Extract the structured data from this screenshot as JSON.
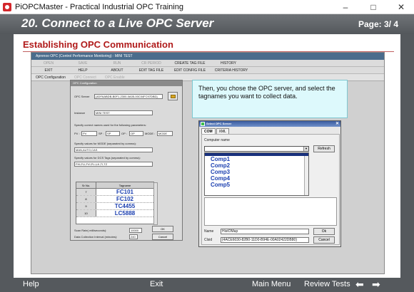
{
  "window": {
    "title": "PiOPCMaster - Practical Industrial OPC Training",
    "minimize": "–",
    "maximize": "□",
    "close": "✕"
  },
  "header": {
    "title": "20. Connect to a Live OPC Server",
    "page": "Page: 3/ 4"
  },
  "slide": {
    "heading": "Establishing OPC Communication"
  },
  "app": {
    "title": "Aprenoo OPC (Control Performance Monitoring) : MINI TEST",
    "menu_row1": [
      "OPEN",
      "SAVE",
      "RUN",
      "CR PERIOD",
      "CREATE TAG FILE",
      "HISTORY"
    ],
    "menu_row2": [
      "EXIT",
      "HELP",
      "ABOUT",
      "EDIT TAG FILE",
      "EDIT CONFIG FILE",
      "CRITERIA HISTORY"
    ],
    "tabs": [
      "OPC Configuration",
      "OPC Connect",
      "OPC Enable"
    ]
  },
  "opc_config": {
    "title": "OPC Configuration",
    "server_label": "OPC Server",
    "server_value": "{4DFAABDB-B0F1-2300-0A05-00C04FC97DBD}",
    "instance_label": "Instance",
    "instance_value": "MINI TEST",
    "params_label": "Specify correct names used for the following parameters:",
    "pv_label": "PV :",
    "pv_value": "PV",
    "sp_label": "SP :",
    "sp_value": "SP",
    "op_label": "OP :",
    "op_value": "OP",
    "mode_label": "MODE :",
    "mode_value": "MODE",
    "mode_values_label": "Specify values for MODE (separated by comma):",
    "mode_values": "MAN,AUTO,CAS",
    "dcs_label": "Specify values for DCS Tags (separated by comma):",
    "dcs_values": "FHI,FLI,FVI,FLI,LK,TI,TZ",
    "table_header_sn": "Sr No.",
    "table_header_tag": "Tagname",
    "rows": [
      {
        "sn": "7",
        "tag": "FC101"
      },
      {
        "sn": "8",
        "tag": "FC102"
      },
      {
        "sn": "9",
        "tag": "TC4455"
      },
      {
        "sn": "10",
        "tag": "LC5888"
      }
    ],
    "scan_label": "Scan Rate( milliseconds):",
    "scan_value": "10000",
    "interval_label": "Data Collection Interval (minutes):",
    "interval_value": "240",
    "ok_label": "OK",
    "cancel_label": "Cancel"
  },
  "callout": {
    "text": "Then, you chose the OPC server, and select the tagnames you want to collect data."
  },
  "select_dialog": {
    "title": "Select OPC Server",
    "tabs": [
      "COM",
      "XML"
    ],
    "computer_label": "Computer name",
    "refresh_label": "Refresh",
    "items": [
      "Comp1",
      "Comp2",
      "Comp3",
      "Comp4",
      "Comp5"
    ],
    "name_label": "Name",
    "name_value": "HistOMap",
    "clsid_label": "Clsid",
    "clsid_value": "{4ACE6030-82B0-11D0-B94E-00A02422DB80}",
    "ok_label": "Ok",
    "cancel_label": "Cancel"
  },
  "footer": {
    "help": "Help",
    "exit": "Exit",
    "main_menu": "Main Menu",
    "review_tests": "Review Tests",
    "prev_arrow": "⬅",
    "next_arrow": "➡"
  }
}
